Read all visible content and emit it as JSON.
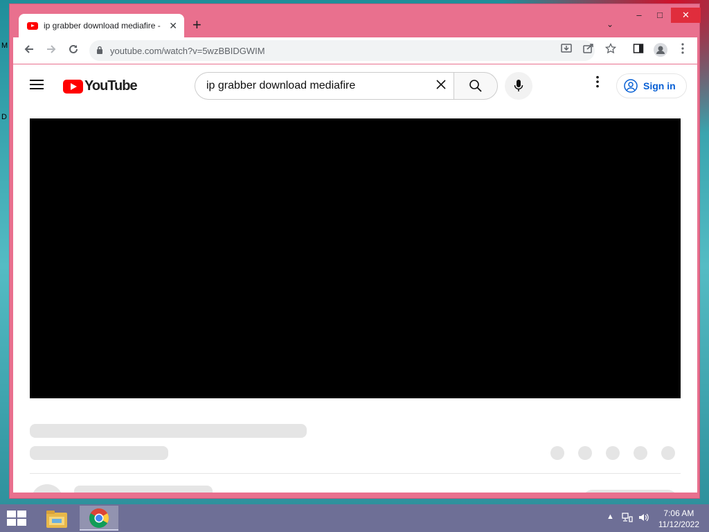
{
  "desktop": {
    "letters": [
      "M",
      "D"
    ]
  },
  "browser": {
    "tab": {
      "title": "ip grabber download mediafire -",
      "close": "✕"
    },
    "new_tab": "+",
    "tab_search": "⌄",
    "window_controls": {
      "minimize": "–",
      "maximize": "□",
      "close": "✕"
    },
    "nav": {
      "back": "←",
      "forward": "→",
      "reload": "↻"
    },
    "omnibox": {
      "url": "youtube.com/watch?v=5wzBBIDGWIM"
    },
    "toolbar_icons": [
      "install-icon",
      "share-icon",
      "bookmark-star-icon",
      "side-panel-icon",
      "profile-icon",
      "menu-icon"
    ],
    "load_progress": 0.55
  },
  "youtube": {
    "logo_text": "YouTube",
    "search": {
      "value": "ip grabber download mediafire"
    },
    "sign_in_label": "Sign in",
    "brand_color": "#ff0000",
    "link_color": "#065fd4"
  },
  "taskbar": {
    "time": "7:06 AM",
    "date": "11/12/2022",
    "tray_arrow": "▲"
  }
}
